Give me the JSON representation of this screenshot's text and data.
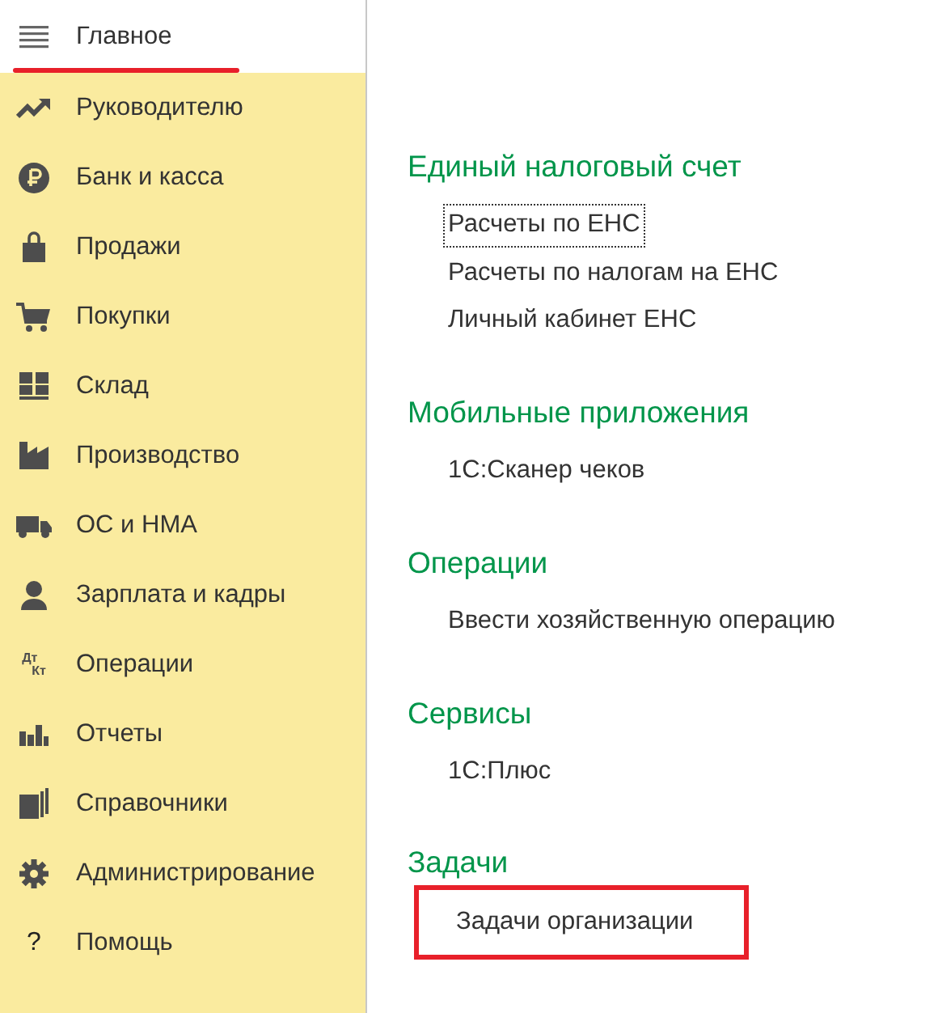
{
  "sidebar": {
    "items": [
      {
        "label": "Главное",
        "selected": true
      },
      {
        "label": "Руководителю",
        "selected": false
      },
      {
        "label": "Банк и касса",
        "selected": false
      },
      {
        "label": "Продажи",
        "selected": false
      },
      {
        "label": "Покупки",
        "selected": false
      },
      {
        "label": "Склад",
        "selected": false
      },
      {
        "label": "Производство",
        "selected": false
      },
      {
        "label": "ОС и НМА",
        "selected": false
      },
      {
        "label": "Зарплата и кадры",
        "selected": false
      },
      {
        "label": "Операции",
        "selected": false,
        "icon_text": [
          "Дт",
          "Кт"
        ]
      },
      {
        "label": "Отчеты",
        "selected": false
      },
      {
        "label": "Справочники",
        "selected": false
      },
      {
        "label": "Администрирование",
        "selected": false
      },
      {
        "label": "Помощь",
        "selected": false,
        "icon_text": [
          "?"
        ]
      }
    ]
  },
  "sections": [
    {
      "title": "Единый налоговый счет",
      "links": [
        {
          "label": "Расчеты по ЕНС",
          "focused": true,
          "highlighted": false
        },
        {
          "label": "Расчеты по налогам на ЕНС",
          "focused": false,
          "highlighted": false
        },
        {
          "label": "Личный кабинет ЕНС",
          "focused": false,
          "highlighted": false
        }
      ]
    },
    {
      "title": "Мобильные приложения",
      "links": [
        {
          "label": "1С:Сканер чеков",
          "focused": false,
          "highlighted": false
        }
      ]
    },
    {
      "title": "Операции",
      "links": [
        {
          "label": "Ввести хозяйственную операцию",
          "focused": false,
          "highlighted": false
        }
      ]
    },
    {
      "title": "Сервисы",
      "links": [
        {
          "label": "1С:Плюс",
          "focused": false,
          "highlighted": false
        }
      ]
    },
    {
      "title": "Задачи",
      "links": [
        {
          "label": "Задачи организации",
          "focused": false,
          "highlighted": true
        }
      ]
    }
  ]
}
